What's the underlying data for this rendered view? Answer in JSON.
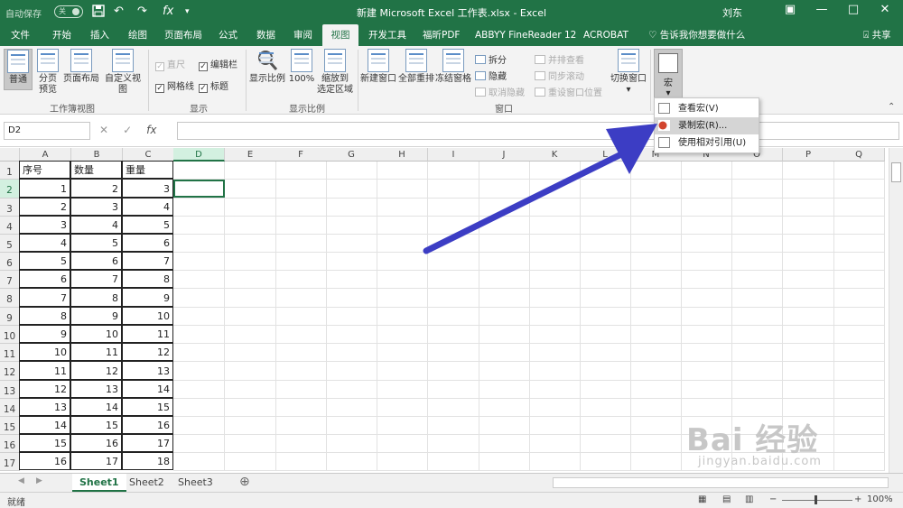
{
  "titlebar": {
    "autosave_label": "自动保存",
    "autosave_state": "关",
    "title": "新建 Microsoft Excel 工作表.xlsx  -  Excel",
    "user": "刘东",
    "qa_save_icon": "save-icon",
    "qa_undo": "↶",
    "qa_redo": "↷",
    "qa_fx": "fx",
    "minimize": "—",
    "restore": "□",
    "close": "✕",
    "ribbon_display": "▣"
  },
  "tabs": [
    "文件",
    "开始",
    "插入",
    "绘图",
    "页面布局",
    "公式",
    "数据",
    "审阅",
    "视图",
    "开发工具",
    "福昕PDF",
    "ABBYY FineReader 12",
    "ACROBAT"
  ],
  "tell_me": "告诉我你想要做什么",
  "share": "共享",
  "ribbon": {
    "normal": "普通",
    "page_break_1": "分页",
    "page_break_2": "预览",
    "page_layout": "页面布局",
    "custom_views": "自定义视图",
    "workbook_views_group": "工作簿视图",
    "ruler": "直尺",
    "formula_bar": "编辑栏",
    "gridlines": "网格线",
    "headings": "标题",
    "show_group": "显示",
    "zoom": "显示比例",
    "zoom100": "100%",
    "zoom_sel_1": "缩放到",
    "zoom_sel_2": "选定区域",
    "zoom_group": "显示比例",
    "new_window": "新建窗口",
    "arrange_all": "全部重排",
    "freeze_panes": "冻结窗格",
    "split": "拆分",
    "hide": "隐藏",
    "unhide": "取消隐藏",
    "side_by_side": "并排查看",
    "sync_scroll": "同步滚动",
    "reset_pos": "重设窗口位置",
    "switch_windows": "切换窗口",
    "window_group": "窗口",
    "macros": "宏"
  },
  "formula_bar": {
    "name_box": "D2",
    "cancel": "✕",
    "enter": "✓",
    "fx": "fx",
    "content": ""
  },
  "columns": [
    "A",
    "B",
    "C",
    "D",
    "E",
    "F",
    "G",
    "H",
    "I",
    "J",
    "K",
    "L",
    "M",
    "N",
    "O",
    "P",
    "Q"
  ],
  "rows": [
    "1",
    "2",
    "3",
    "4",
    "5",
    "6",
    "7",
    "8",
    "9",
    "10",
    "11",
    "12",
    "13",
    "14",
    "15",
    "16",
    "17"
  ],
  "table": {
    "headers": [
      "序号",
      "数量",
      "重量"
    ],
    "data": [
      [
        1,
        2,
        3
      ],
      [
        2,
        3,
        4
      ],
      [
        3,
        4,
        5
      ],
      [
        4,
        5,
        6
      ],
      [
        5,
        6,
        7
      ],
      [
        6,
        7,
        8
      ],
      [
        7,
        8,
        9
      ],
      [
        8,
        9,
        10
      ],
      [
        9,
        10,
        11
      ],
      [
        10,
        11,
        12
      ],
      [
        11,
        12,
        13
      ],
      [
        12,
        13,
        14
      ],
      [
        13,
        14,
        15
      ],
      [
        14,
        15,
        16
      ],
      [
        15,
        16,
        17
      ],
      [
        16,
        17,
        18
      ]
    ]
  },
  "sheets": [
    "Sheet1",
    "Sheet2",
    "Sheet3"
  ],
  "add_sheet": "⊕",
  "status": {
    "ready": "就绪",
    "zoom": "100%"
  },
  "macro_menu": [
    "查看宏(V)",
    "录制宏(R)...",
    "使用相对引用(U)"
  ],
  "watermark": {
    "brand": "Bai 经验",
    "url": "jingyan.baidu.com"
  },
  "colors": {
    "excel_green": "#217346",
    "arrow": "#3c3dc4"
  }
}
